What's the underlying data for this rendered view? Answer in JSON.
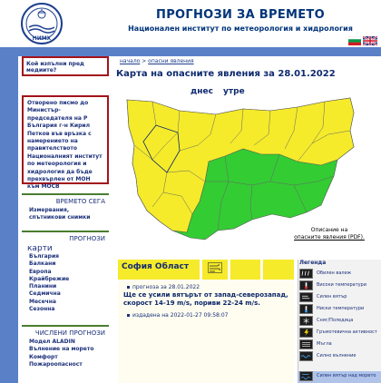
{
  "header": {
    "title": "ПРОГНОЗИ ЗА ВРЕМЕТО",
    "subtitle": "Национален институт по метеорология и хидрология",
    "logo_text": "НИМХ"
  },
  "breadcrumb": {
    "home": "начало",
    "separator": " > ",
    "current": "опасни явления"
  },
  "sidebar": {
    "who_label": "Кой изпълни пред медиите?",
    "letter_text": "Отворено писмо до Министър-председателя на Р България г-н Кирил Петков във връзка с намерението на правителството Националният институт по метеорология и хидрология да бъде прехвърлен от МОН към МОСВ",
    "now": {
      "heading": "ВРЕМЕТО СЕГА",
      "items": [
        "Измервания,",
        "спътникови снимки"
      ]
    },
    "forecasts": {
      "heading": "ПРОГНОЗИ",
      "maps_label": "карти",
      "items": [
        "България",
        "Балкани",
        "Европа",
        "Крайбрежие",
        "Планини",
        "Седмична",
        "Месечна",
        "Сезонна"
      ]
    },
    "numerical": {
      "heading": "ЧИСЛЕНИ ПРОГНОЗИ",
      "items": [
        "Модел ALADIN",
        "Вълнение на морето",
        "Комфорт",
        "Пожароопасност"
      ]
    }
  },
  "main": {
    "title": "Карта на опасните явления за 28.01.2022",
    "subtitle": "днес утре",
    "note_line1": "Описание на",
    "note_line2": "опасните явления (PDF)."
  },
  "region": {
    "name": "София Област",
    "forecast_date": "прогноза за 28.01.2022",
    "text": "Ще се усили вятърът от запад-северозапад, скорост 14-19 m/s, пориви 22-24 m/s.",
    "issued": "издадена на 2022-01-27 09:58:07"
  },
  "legend": {
    "title": "Легенда",
    "items": [
      {
        "icon": "heavy-rain-icon",
        "label": "Обилен валеж"
      },
      {
        "icon": "high-temperature-icon",
        "label": "Високи температури"
      },
      {
        "icon": "strong-wind-icon",
        "label": "Силен вятър"
      },
      {
        "icon": "low-temperature-icon",
        "label": "Ниски температури"
      },
      {
        "icon": "snow-ice-icon",
        "label": "Сняг/Поледица"
      },
      {
        "icon": "thunderstorm-icon",
        "label": "Гръмотевична активност"
      },
      {
        "icon": "fog-icon",
        "label": "Мъгла"
      },
      {
        "icon": "sea-waves-icon",
        "label": "Силно вълнение"
      },
      {
        "icon": "wind-sea-icon",
        "label": "Силен вятър над морето"
      }
    ]
  },
  "colors": {
    "blue_bar": "#5a80c8",
    "warning_yellow": "#f5eb2a",
    "no_warning_green": "#33cc33",
    "sidebar_border": "#a3131a",
    "text_navy": "#1b2f7a"
  }
}
